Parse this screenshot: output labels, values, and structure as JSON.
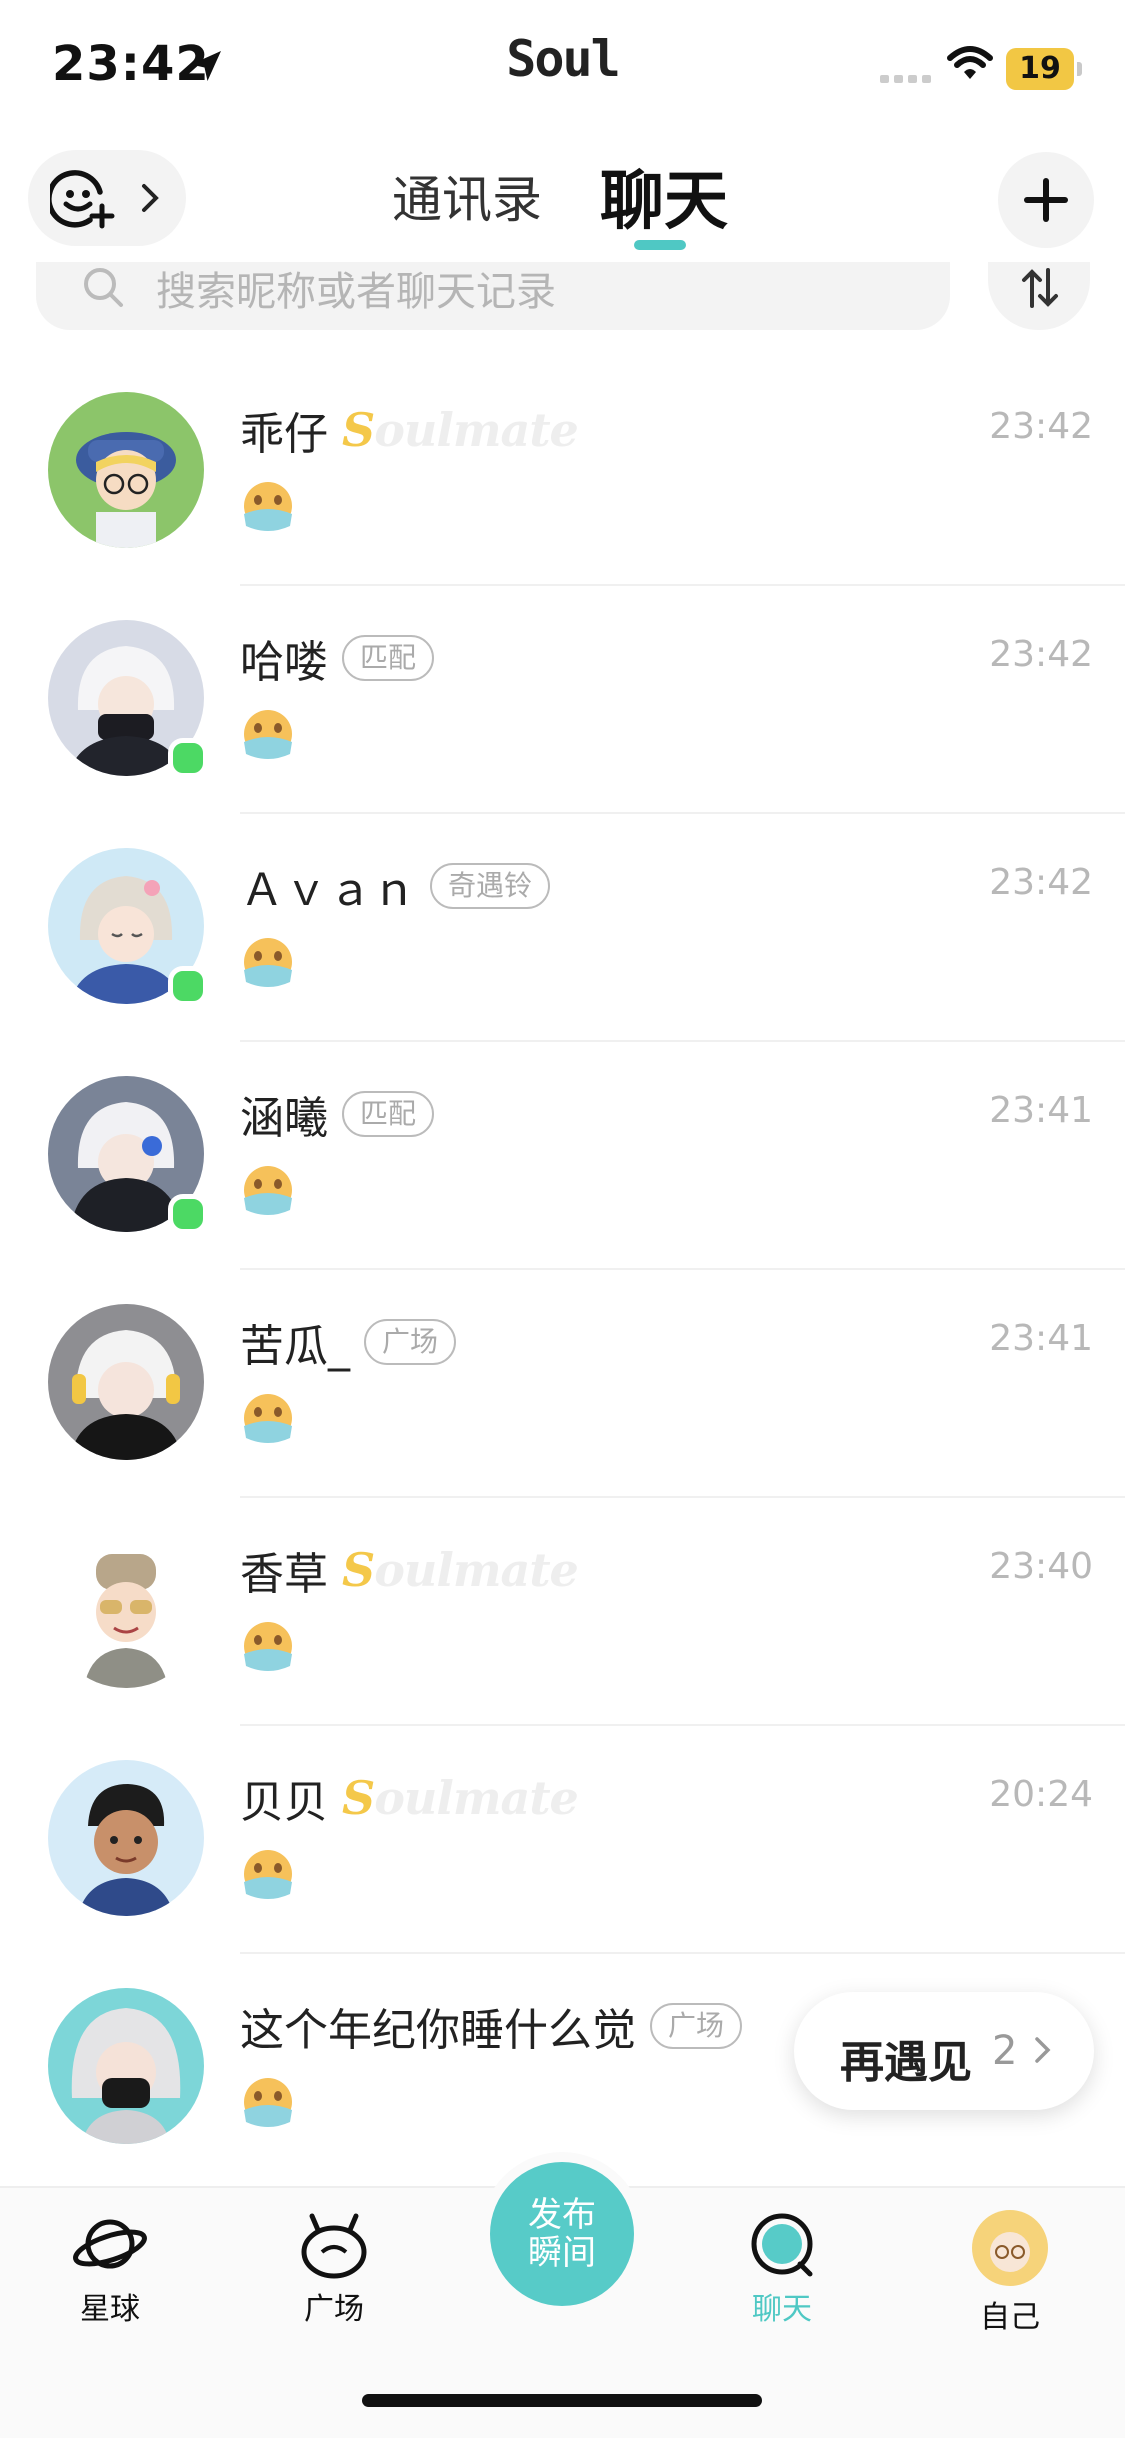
{
  "status_bar": {
    "time": "23:42",
    "brand": "Soul",
    "battery": "19",
    "battery_color": "#f2c744"
  },
  "header": {
    "emoji_button_icon": "smiley-plus-icon",
    "tab_contacts": "通讯录",
    "tab_chat": "聊天",
    "accent_color": "#4fc8c4"
  },
  "search": {
    "placeholder": "搜索昵称或者聊天记录"
  },
  "chats": [
    {
      "name": "乖仔",
      "badge_type": "soulmate",
      "badge": "Soulmate",
      "time": "23:42",
      "online": false
    },
    {
      "name": "哈喽",
      "badge_type": "tag",
      "badge": "匹配",
      "time": "23:42",
      "online": true
    },
    {
      "name": "Ａｖａｎ",
      "badge_type": "tag",
      "badge": "奇遇铃",
      "time": "23:42",
      "online": true
    },
    {
      "name": "涵曦",
      "badge_type": "tag",
      "badge": "匹配",
      "time": "23:41",
      "online": true
    },
    {
      "name": "苦瓜_",
      "badge_type": "tag",
      "badge": "广场",
      "time": "23:41",
      "online": false
    },
    {
      "name": "香草",
      "badge_type": "soulmate",
      "badge": "Soulmate",
      "time": "23:40",
      "online": false
    },
    {
      "name": "贝贝",
      "badge_type": "soulmate",
      "badge": "Soulmate",
      "time": "20:24",
      "online": false
    },
    {
      "name": "这个年纪你睡什么觉",
      "badge_type": "tag",
      "badge": "广场",
      "time": "",
      "online": false
    }
  ],
  "meet_again": {
    "label": "再遇见",
    "count": "2"
  },
  "bottom_nav": {
    "planet": "星球",
    "square": "广场",
    "publish_line1": "发布",
    "publish_line2": "瞬间",
    "chat": "聊天",
    "self": "自己"
  }
}
